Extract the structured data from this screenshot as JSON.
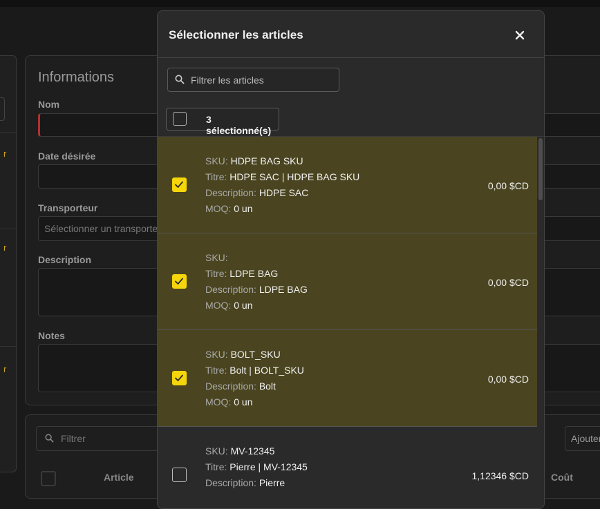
{
  "background": {
    "info_title": "Informations",
    "labels": {
      "nom": "Nom",
      "date": "Date désirée",
      "transporteur": "Transporteur",
      "description": "Description",
      "notes": "Notes"
    },
    "transporteur_placeholder": "Sélectionner un transporteur",
    "filter_placeholder": "Filtrer",
    "add_button": "Ajouter",
    "columns": {
      "article": "Article",
      "cout": "Coût"
    },
    "left_marks": [
      "r",
      "r",
      "r"
    ]
  },
  "modal": {
    "title": "Sélectionner les articles",
    "search_placeholder": "Filtrer les articles",
    "selected_count": "3 sélectionné(s)",
    "labels": {
      "sku": "SKU:",
      "titre": "Titre:",
      "description": "Description:",
      "moq": "MOQ:"
    },
    "items": [
      {
        "selected": true,
        "sku": "HDPE BAG SKU",
        "titre": "HDPE SAC | HDPE BAG SKU",
        "description": "HDPE SAC",
        "moq": "0 un",
        "price": "0,00 $CD"
      },
      {
        "selected": true,
        "sku": "",
        "titre": "LDPE BAG",
        "description": "LDPE BAG",
        "moq": "0 un",
        "price": "0,00 $CD"
      },
      {
        "selected": true,
        "sku": "BOLT_SKU",
        "titre": "Bolt | BOLT_SKU",
        "description": "Bolt",
        "moq": "0 un",
        "price": "0,00 $CD"
      },
      {
        "selected": false,
        "sku": "MV-12345",
        "titre": "Pierre | MV-12345",
        "description": "Pierre",
        "moq": "",
        "price": "1,12346 $CD"
      }
    ]
  },
  "colors": {
    "selected_row": "#4a4520",
    "checkbox_accent": "#f5d60a",
    "required_marker": "#b23030"
  }
}
